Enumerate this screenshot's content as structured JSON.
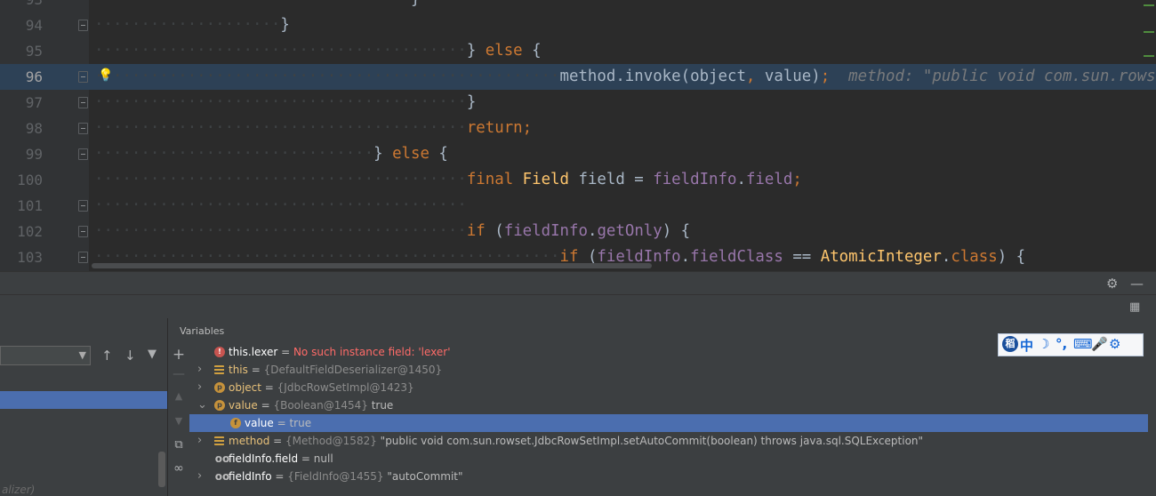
{
  "editor": {
    "lines": [
      {
        "num": "94",
        "indent": "····················",
        "parts": [
          {
            "t": "}",
            "c": ""
          }
        ]
      },
      {
        "num": "95",
        "indent": "········································",
        "parts": [
          {
            "t": "} ",
            "c": ""
          },
          {
            "t": "else",
            "c": "kw"
          },
          {
            "t": " {",
            "c": ""
          }
        ]
      },
      {
        "num": "96",
        "indent": "··················································",
        "exec": true,
        "parts": [
          {
            "t": "method.invoke(object",
            "c": ""
          },
          {
            "t": ",",
            "c": "kw"
          },
          {
            "t": " value)",
            "c": ""
          },
          {
            "t": ";",
            "c": "kw"
          },
          {
            "t": "  method: \"public void com.sun.rowset.JdbcRowSetImpl.setAut",
            "c": "hint"
          }
        ]
      },
      {
        "num": "97",
        "indent": "········································",
        "parts": [
          {
            "t": "}",
            "c": ""
          }
        ]
      },
      {
        "num": "98",
        "indent": "········································",
        "parts": [
          {
            "t": "return",
            "c": "kw"
          },
          {
            "t": ";",
            "c": "kw"
          }
        ]
      },
      {
        "num": "99",
        "indent": "······························",
        "parts": [
          {
            "t": "} ",
            "c": ""
          },
          {
            "t": "else",
            "c": "kw"
          },
          {
            "t": " {",
            "c": ""
          }
        ]
      },
      {
        "num": "100",
        "indent": "········································",
        "parts": [
          {
            "t": "final ",
            "c": "kw"
          },
          {
            "t": "Field",
            "c": "cls"
          },
          {
            "t": " field = ",
            "c": ""
          },
          {
            "t": "fieldInfo",
            "c": "fld"
          },
          {
            "t": ".",
            "c": ""
          },
          {
            "t": "field",
            "c": "fld"
          },
          {
            "t": ";",
            "c": "kw"
          }
        ]
      },
      {
        "num": "101",
        "indent": "········································",
        "parts": []
      },
      {
        "num": "102",
        "indent": "········································",
        "parts": [
          {
            "t": "if",
            "c": "kw"
          },
          {
            "t": " (",
            "c": ""
          },
          {
            "t": "fieldInfo",
            "c": "fld"
          },
          {
            "t": ".",
            "c": ""
          },
          {
            "t": "getOnly",
            "c": "fld"
          },
          {
            "t": ") {",
            "c": ""
          }
        ]
      },
      {
        "num": "103",
        "indent": "··················································",
        "parts": [
          {
            "t": "if",
            "c": "kw"
          },
          {
            "t": " (",
            "c": ""
          },
          {
            "t": "fieldInfo",
            "c": "fld"
          },
          {
            "t": ".",
            "c": ""
          },
          {
            "t": "fieldClass",
            "c": "fld"
          },
          {
            "t": " == ",
            "c": ""
          },
          {
            "t": "AtomicInteger",
            "c": "cls"
          },
          {
            "t": ".",
            "c": ""
          },
          {
            "t": "class",
            "c": "kw"
          },
          {
            "t": ") {",
            "c": ""
          }
        ]
      }
    ]
  },
  "debug_panel": {
    "variables_title": "Variables",
    "variables": [
      {
        "icon": "error",
        "icon_glyph": "!",
        "name": "this.lexer",
        "eq": " = ",
        "value": "No such instance field: 'lexer'",
        "value_style": "err",
        "expand": ""
      },
      {
        "icon": "list",
        "icon_glyph": "",
        "name": "this",
        "eq": " = ",
        "ref": "{DefaultFieldDeserializer@1450}",
        "value": "",
        "expand": "›"
      },
      {
        "icon": "param",
        "icon_glyph": "p",
        "name": "object",
        "eq": " = ",
        "ref": "{JdbcRowSetImpl@1423}",
        "value": "",
        "expand": "›"
      },
      {
        "icon": "param",
        "icon_glyph": "p",
        "name": "value",
        "eq": " = ",
        "ref": "{Boolean@1454}",
        "value": " true",
        "expand": "⌄"
      },
      {
        "icon": "field",
        "icon_glyph": "f",
        "name": "value",
        "eq": " = ",
        "ref": "",
        "value": "true",
        "selected": true,
        "indent": true,
        "expand": ""
      },
      {
        "icon": "list",
        "icon_glyph": "",
        "name": "method",
        "eq": " = ",
        "ref": "{Method@1582}",
        "value": " \"public void com.sun.rowset.JdbcRowSetImpl.setAutoCommit(boolean) throws java.sql.SQLException\"",
        "expand": "›"
      },
      {
        "icon": "watch",
        "icon_glyph": "oo",
        "name": "fieldInfo.field",
        "eq": " = ",
        "ref": "",
        "value": "null",
        "expand": ""
      },
      {
        "icon": "watch",
        "icon_glyph": "oo",
        "name": "fieldInfo",
        "eq": " = ",
        "ref": "{FieldInfo@1455}",
        "value": " \"autoCommit\"",
        "expand": "›"
      }
    ],
    "frames_faint_text": "alizer)"
  },
  "ime_bar": {
    "icons": [
      "稻",
      "中",
      "☽",
      "°,",
      "⌨",
      "🎤",
      "⚙"
    ]
  }
}
